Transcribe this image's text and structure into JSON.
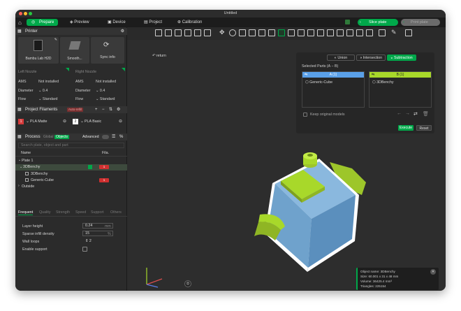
{
  "window": {
    "title": "Untitled"
  },
  "tabs": {
    "prepare": "Prepare",
    "preview": "Preview",
    "device": "Device",
    "project": "Project",
    "calibration": "Calibration"
  },
  "actions": {
    "slice_plate": "Slice plate",
    "print_plate": "Print plate"
  },
  "printer": {
    "section_title": "Printer",
    "name": "Bambu Lab H2D",
    "plate": "Smooth...",
    "sync": "Sync info",
    "left_nozzle": "Left Nozzle",
    "right_nozzle": "Right Nozzle",
    "ams_label": "AMS",
    "ams_value": "Not installed",
    "diameter_label": "Diameter",
    "diameter_value": "0.4",
    "flow_label": "Flow",
    "flow_value": "Standard"
  },
  "filaments": {
    "section_title": "Project Filaments",
    "badge": "Auto-refill",
    "items": [
      {
        "index": "1",
        "name": "PLA Matte",
        "color": "#d63b3b"
      },
      {
        "index": "2",
        "name": "PLA Basic",
        "color": "#ffffff"
      }
    ]
  },
  "process": {
    "section_title": "Process",
    "global": "Global",
    "objects": "Objects",
    "advanced": "Advanced",
    "search_placeholder": "Search plate, object and part",
    "col_name": "Name",
    "col_fila": "Fila.",
    "tree": [
      {
        "label": "Plate 1",
        "level": 0
      },
      {
        "label": "3DBenchy",
        "level": 1,
        "fila": "1"
      },
      {
        "label": "3DBenchy",
        "level": 2,
        "fila": ""
      },
      {
        "label": "Generic-Cube",
        "level": 2,
        "fila": "1"
      },
      {
        "label": "Outside",
        "level": 0
      }
    ],
    "subtabs": [
      "Frequent",
      "Quality",
      "Strength",
      "Speed",
      "Support",
      "Others"
    ],
    "settings": [
      {
        "label": "Layer height",
        "value": "0.24",
        "unit": "mm"
      },
      {
        "label": "Sparse infill density",
        "value": "15",
        "unit": "%"
      },
      {
        "label": "Wall loops",
        "value": "2",
        "unit": ""
      },
      {
        "label": "Enable support",
        "value": "",
        "unit": ""
      }
    ]
  },
  "viewport": {
    "return_label": "return",
    "boolean": {
      "tabs": [
        "Union",
        "Intersection",
        "Subtraction"
      ],
      "selected_parts_label": "Selected Parts (A − B)",
      "part_a_header": "A (1)",
      "part_b_header": "B (1)",
      "part_a_item": "Generic-Cube",
      "part_b_item": "3DBenchy",
      "keep_original": "Keep original models",
      "execute": "Execute",
      "reset": "Reset"
    },
    "info": {
      "lines": [
        "Object name: 3DBenchy",
        "Size: 60.001 x 31 x 48 mm",
        "Volume: 36425.4 mm³",
        "Triangles: 225154"
      ]
    }
  },
  "colors": {
    "accent": "#00a84a",
    "lime": "#a8d82a",
    "blue_a": "#5aa0e8"
  }
}
